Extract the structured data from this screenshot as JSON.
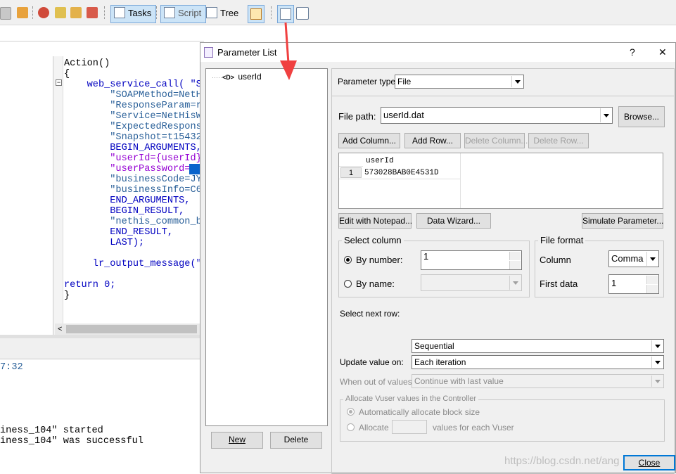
{
  "toolbar": {
    "tasks_label": "Tasks",
    "script_label": "Script",
    "tree_label": "Tree"
  },
  "editor": {
    "lines": [
      "Action()",
      "{",
      "    web_service_call( \"S",
      "        \"SOAPMethod=NetH",
      "        \"ResponseParam=r",
      "        \"Service=NetHisW",
      "        \"ExpectedRespons",
      "        \"Snapshot=t15432",
      "        BEGIN_ARGUMENTS,",
      "        \"userId={userId}",
      "        \"userPassword=57",
      "        \"businessCode=JY",
      "        \"businessInfo=C6",
      "        END_ARGUMENTS,",
      "        BEGIN_RESULT,",
      "        \"nethis_common_b",
      "        END_RESULT,",
      "        LAST);",
      "",
      "     lr_output_message(\"",
      "",
      "return 0;",
      "}"
    ],
    "output_lines": [
      "7:32",
      "",
      "",
      "",
      "",
      "",
      "iness_104\" started",
      "iness_104\" was successful"
    ]
  },
  "dialog": {
    "title": "Parameter List",
    "help_label": "?",
    "close_x": "✕",
    "tree_item": "userId",
    "tree_item_icon_text": "<D>",
    "new_label": "New",
    "delete_label": "Delete",
    "parameter_type_label": "Parameter type:",
    "parameter_type_value": "File",
    "file_path_label": "File path:",
    "file_path_value": "userId.dat",
    "browse_label": "Browse...",
    "add_column_label": "Add Column...",
    "add_row_label": "Add Row...",
    "delete_column_label": "Delete Column...",
    "delete_row_label": "Delete Row...",
    "table": {
      "header": "userId",
      "rows": [
        {
          "num": "1",
          "value": "573028BAB0E4531D"
        }
      ]
    },
    "edit_notepad_label": "Edit with Notepad...",
    "data_wizard_label": "Data Wizard...",
    "simulate_label": "Simulate Parameter...",
    "select_column": {
      "title": "Select column",
      "by_number_label": "By number:",
      "by_number_value": "1",
      "by_name_label": "By name:",
      "by_name_value": ""
    },
    "file_format": {
      "title": "File format",
      "column_label": "Column",
      "column_value": "Comma",
      "first_data_label": "First data",
      "first_data_value": "1"
    },
    "select_next_row_label": "Select next row:",
    "select_next_row_value": "Sequential",
    "update_value_label": "Update value on:",
    "update_value_value": "Each iteration",
    "out_of_values_label": "When out of values:",
    "out_of_values_value": "Continue with last value",
    "allocate": {
      "title": "Allocate Vuser values in the Controller",
      "auto_label": "Automatically allocate block size",
      "allocate_label": "Allocate",
      "allocate_value": "",
      "suffix_label": "values for each Vuser"
    },
    "close_label": "Close"
  },
  "watermark": "https://blog.csdn.net/ang",
  "colors": {
    "accent_highlight": "#cce4f7",
    "code_keyword": "#0000c0",
    "code_string": "#2a6099",
    "code_param": "#9400d3",
    "selection": "#0a64cc",
    "red_arrow": "#f04040"
  }
}
